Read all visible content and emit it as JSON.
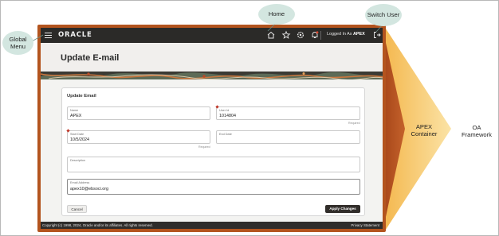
{
  "callouts": {
    "global_menu": "Global Menu",
    "home": "Home",
    "switch_user": "Switch User",
    "apex_container": "APEX Container",
    "oa_framework": "OA Framework"
  },
  "topbar": {
    "brand": "ORACLE",
    "logged_in_prefix": "Logged In As",
    "logged_in_user": "APEX",
    "icons": [
      "home-icon",
      "star-icon",
      "gear-icon",
      "bell-icon",
      "switch-user-icon"
    ]
  },
  "page": {
    "title": "Update E-mail"
  },
  "form": {
    "card_title": "Update Email",
    "name_label": "Name",
    "name_value": "APEX",
    "user_id_label": "User Id",
    "user_id_value": "1014804",
    "required_text": "Required",
    "start_date_label": "Start Date",
    "start_date_value": "10/5/2024",
    "end_date_label": "End Date",
    "description_label": "Description",
    "email_label": "Email Address",
    "email_value": "apex10@ebsoci.org",
    "cancel_label": "Cancel",
    "apply_label": "Apply Changes"
  },
  "footer": {
    "copyright": "Copyright (c) 1998, 2024, Oracle and/or its affiliates. All rights reserved.",
    "privacy": "Privacy Statement"
  },
  "colors": {
    "container_accent": "#b3541e",
    "framework_fill": "#f5c46a",
    "topbar": "#2b2a28",
    "callout_bg": "#d3e6e0"
  }
}
